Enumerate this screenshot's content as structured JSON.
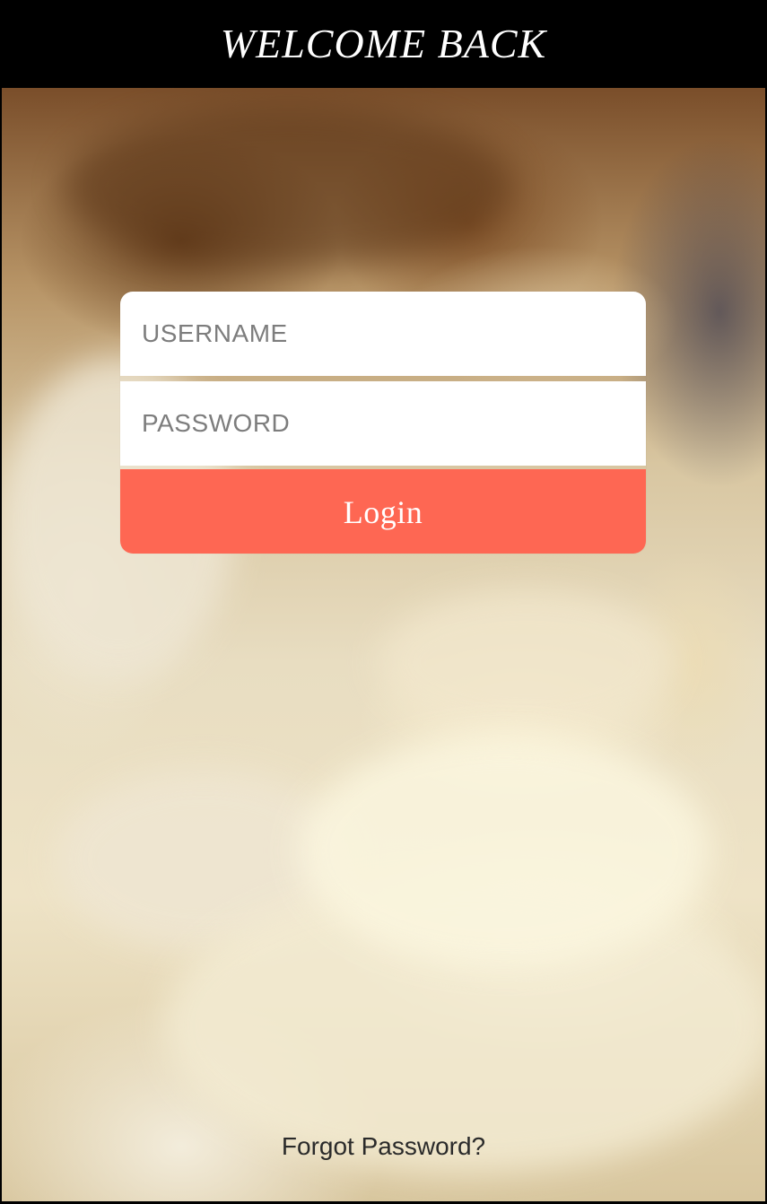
{
  "header": {
    "title": "WELCOME BACK"
  },
  "login_form": {
    "username_placeholder": "USERNAME",
    "password_placeholder": "PASSWORD",
    "login_label": "Login"
  },
  "footer": {
    "forgot_password": "Forgot Password?"
  },
  "colors": {
    "header_bg": "#000000",
    "accent": "#fe6753",
    "field_bg": "#ffffff",
    "placeholder_text": "#7d7d7d"
  }
}
